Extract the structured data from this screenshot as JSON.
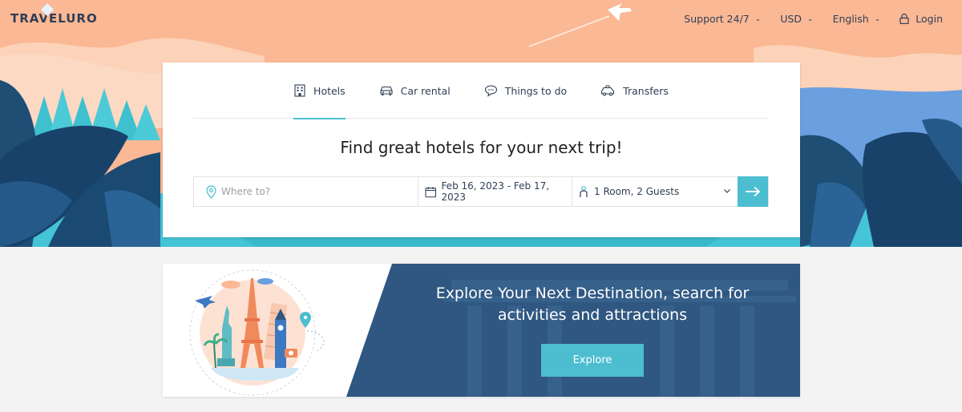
{
  "brand": {
    "logo_text": "TRAVELURO"
  },
  "nav": {
    "support": "Support 24/7",
    "currency": "USD",
    "language": "English",
    "login": "Login"
  },
  "search": {
    "tabs": [
      {
        "label": "Hotels",
        "icon": "hotel-icon",
        "active": true
      },
      {
        "label": "Car rental",
        "icon": "car-icon",
        "active": false
      },
      {
        "label": "Things to do",
        "icon": "chat-bubble-icon",
        "active": false
      },
      {
        "label": "Transfers",
        "icon": "transfer-car-icon",
        "active": false
      }
    ],
    "headline": "Find great hotels for your next trip!",
    "where_placeholder": "Where to?",
    "dates": "Feb 16, 2023 - Feb 17, 2023",
    "guests": "1 Room, 2 Guests"
  },
  "promo": {
    "title": "Explore Your Next Destination, search for activities and attractions",
    "button": "Explore"
  },
  "colors": {
    "accent": "#4dbdd0",
    "navy": "#2f3e56",
    "peach": "#fbb894"
  }
}
